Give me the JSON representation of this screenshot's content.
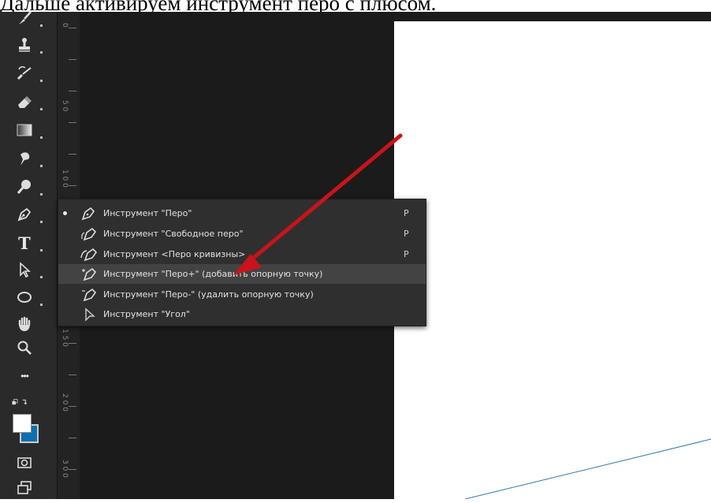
{
  "caption": "Дальше активируем инструмент перо с плюсом.",
  "colors": {
    "canvas": "#ffffff",
    "workspace": "#1b1b1b",
    "toolbar": "#2a2a2a",
    "flyout": "#2f2f2f",
    "highlight": "#434343",
    "arrow": "#c8141a"
  },
  "toolbar": {
    "tools": [
      {
        "name": "brush-tool",
        "icon": "brush-icon"
      },
      {
        "name": "clone-stamp-tool",
        "icon": "stamp-icon"
      },
      {
        "name": "history-brush-tool",
        "icon": "history-brush-icon"
      },
      {
        "name": "eraser-tool",
        "icon": "eraser-icon"
      },
      {
        "name": "gradient-tool",
        "icon": "gradient-icon"
      },
      {
        "name": "smudge-tool",
        "icon": "smudge-icon"
      },
      {
        "name": "dodge-tool",
        "icon": "dodge-icon"
      },
      {
        "name": "pen-tool",
        "icon": "pen-icon"
      },
      {
        "name": "type-tool",
        "icon": "type-icon",
        "glyph": "T"
      },
      {
        "name": "path-selection-tool",
        "icon": "cursor-arrow-icon"
      },
      {
        "name": "ellipse-tool",
        "icon": "ellipse-icon"
      },
      {
        "name": "hand-tool",
        "icon": "hand-icon"
      },
      {
        "name": "zoom-tool",
        "icon": "zoom-icon"
      },
      {
        "name": "more-tools",
        "icon": "more-icon",
        "glyph": "•••"
      },
      {
        "name": "swap-colors",
        "icon": "swap-colors-icon"
      },
      {
        "name": "quick-mask",
        "icon": "quick-mask-icon"
      },
      {
        "name": "screen-mode",
        "icon": "screen-mode-icon"
      }
    ]
  },
  "ruler": {
    "labels": [
      "0",
      "5 0",
      "1 0 0",
      "1 5 0",
      "2 0 0",
      "2 5 0",
      "3 0 0"
    ]
  },
  "pen_menu": {
    "items": [
      {
        "label": "Инструмент \"Перо\"",
        "shortcut": "P",
        "icon": "pen-icon",
        "active": true
      },
      {
        "label": "Инструмент \"Свободное перо\"",
        "shortcut": "P",
        "icon": "freeform-pen-icon"
      },
      {
        "label": "Инструмент <Перо кривизны>",
        "shortcut": "P",
        "icon": "curvature-pen-icon"
      },
      {
        "label": "Инструмент \"Перо+\" (добавить опорную точку)",
        "shortcut": "",
        "icon": "add-anchor-point-icon",
        "highlighted": true
      },
      {
        "label": "Инструмент \"Перо-\" (удалить опорную точку)",
        "shortcut": "",
        "icon": "delete-anchor-point-icon"
      },
      {
        "label": "Инструмент \"Угол\"",
        "shortcut": "",
        "icon": "convert-point-icon"
      }
    ]
  }
}
